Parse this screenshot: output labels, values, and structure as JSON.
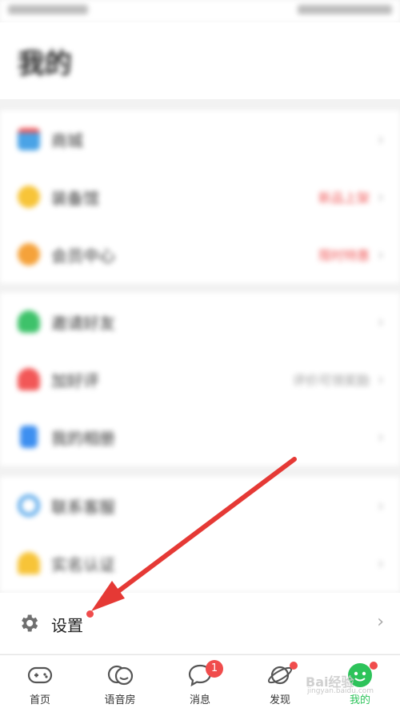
{
  "page": {
    "title": "我的"
  },
  "groups": [
    {
      "items": [
        {
          "label": "商城",
          "icon": "calendar-icon",
          "color": "#4aa3e6",
          "value": ""
        },
        {
          "label": "装备馆",
          "icon": "coin-icon",
          "color": "#f7c438",
          "value": "新品上架"
        },
        {
          "label": "会员中心",
          "icon": "vip-icon",
          "color": "#f5a23a",
          "value": "限时特惠"
        }
      ]
    },
    {
      "items": [
        {
          "label": "邀请好友",
          "icon": "tree-icon",
          "color": "#3ec26a",
          "value": ""
        },
        {
          "label": "加好评",
          "icon": "heart-icon",
          "color": "#f25757",
          "value": "评价可领奖励"
        },
        {
          "label": "我的相册",
          "icon": "file-icon",
          "color": "#3d8ff0",
          "value": ""
        }
      ]
    },
    {
      "items": [
        {
          "label": "联系客服",
          "icon": "headset-icon",
          "color": "#59a8ea",
          "value": ""
        },
        {
          "label": "实名认证",
          "icon": "shield-icon",
          "color": "#f7c438",
          "value": ""
        }
      ]
    }
  ],
  "settings": {
    "label": "设置",
    "icon": "gear-icon"
  },
  "tabbar": {
    "tabs": [
      {
        "label": "首页",
        "icon": "gamepad-icon",
        "badge": ""
      },
      {
        "label": "语音房",
        "icon": "voice-room-icon",
        "badge": ""
      },
      {
        "label": "消息",
        "icon": "chat-bubble-icon",
        "badge": "1"
      },
      {
        "label": "发现",
        "icon": "planet-icon",
        "badge": "dot"
      },
      {
        "label": "我的",
        "icon": "profile-icon",
        "badge": "dot"
      }
    ],
    "active_color": "#2dc35a"
  },
  "watermark": {
    "text": "Bai经验",
    "sub": "jingyan.baidu.com"
  }
}
